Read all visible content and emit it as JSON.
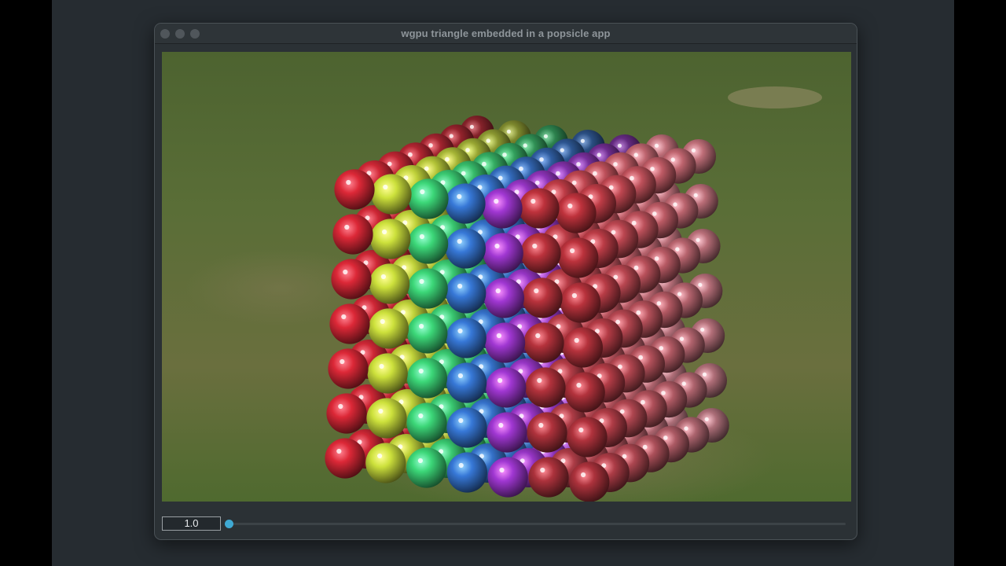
{
  "window": {
    "title": "wgpu triangle embedded in a popsicle app"
  },
  "controls": {
    "scale_value": "1.0",
    "slider_fraction": 0.0,
    "accent_color": "#3fa9d3"
  },
  "scene": {
    "description_icon": "sphere-cube-render",
    "grid_size": 7
  }
}
